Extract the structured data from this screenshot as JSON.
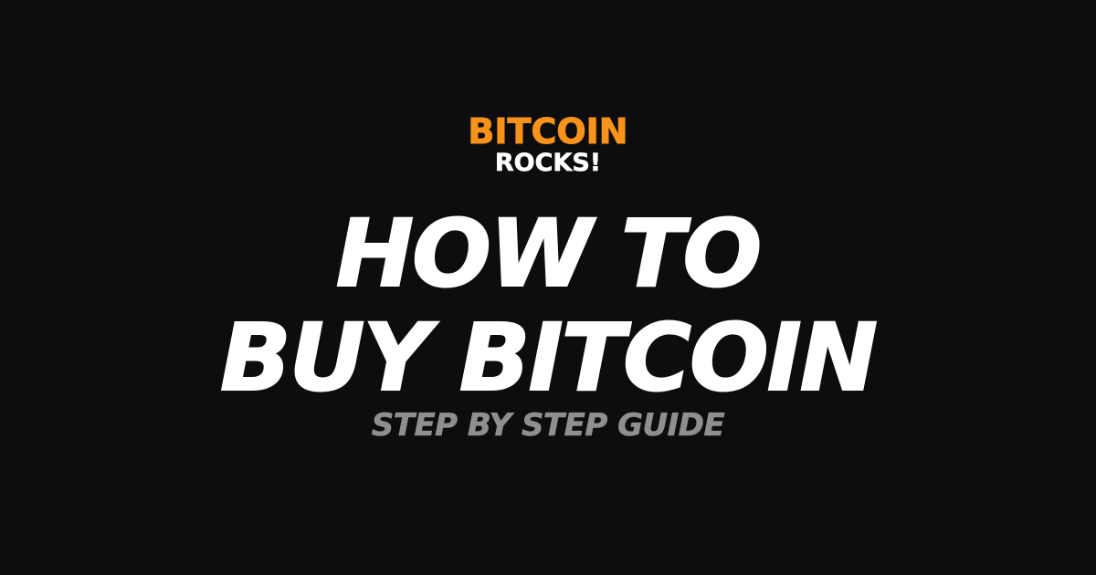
{
  "logo": {
    "line1": "BITCOIN",
    "line2": "ROCKS!",
    "line1_color": "#f7931a",
    "line2_color": "#ffffff"
  },
  "headline": {
    "line1": "HOW TO",
    "line2": "BUY BITCOIN",
    "color": "#ffffff"
  },
  "subtitle": {
    "text": "STEP BY STEP GUIDE",
    "color": "#8f8f8f"
  },
  "background_color": "#0d0d10"
}
